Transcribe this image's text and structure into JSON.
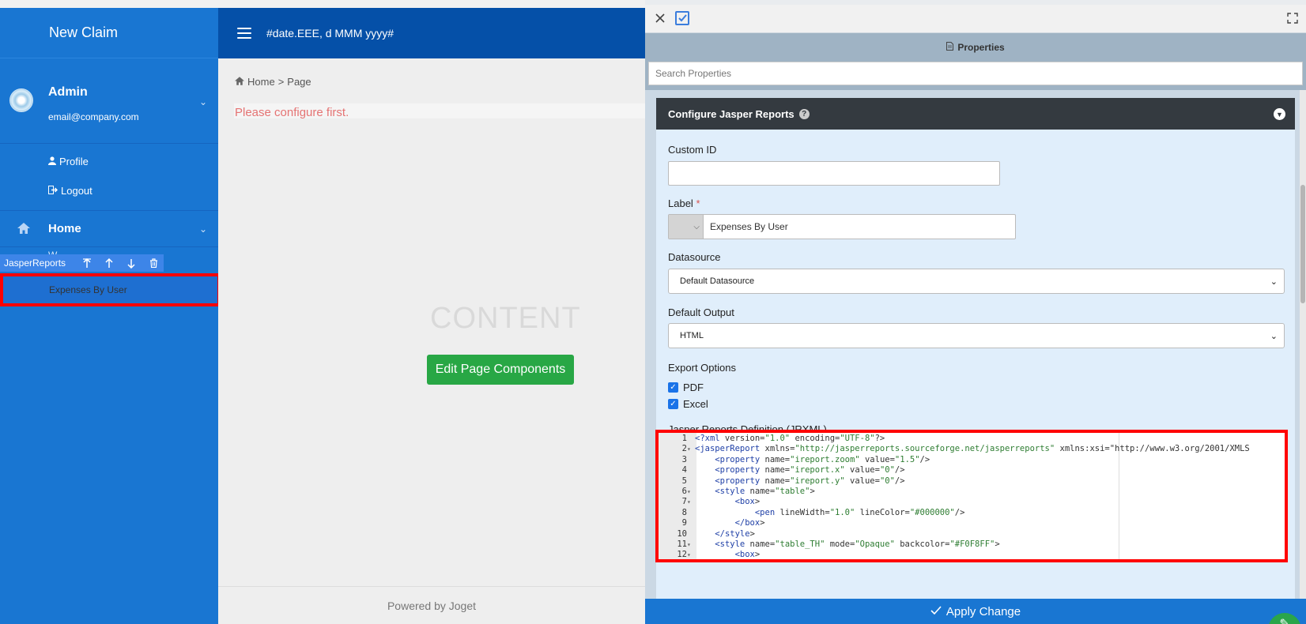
{
  "app": {
    "brand": "New Claim",
    "topbar_date": "#date.EEE, d MMM yyyy#"
  },
  "user": {
    "name": "Admin",
    "email": "email@company.com",
    "menu": [
      {
        "label": "Profile",
        "icon": "user-icon"
      },
      {
        "label": "Logout",
        "icon": "logout-icon"
      }
    ]
  },
  "nav": {
    "home_label": "Home",
    "hidden_item_peek": "W...",
    "builder_toolbar": {
      "label": "JasperReports",
      "actions": [
        "move-up-left-icon",
        "move-up-icon",
        "move-down-icon",
        "delete-icon"
      ]
    },
    "selected_item": "Expenses By User"
  },
  "main": {
    "breadcrumb": {
      "home": "Home",
      "sep": ">",
      "current": "Page"
    },
    "alert": "Please configure first.",
    "content_placeholder": "CONTENT",
    "edit_button": "Edit Page Components",
    "footer": "Powered by Joget"
  },
  "panel": {
    "title": "Properties",
    "search_placeholder": "Search Properties",
    "section_title": "Configure Jasper Reports",
    "fields": {
      "custom_id_label": "Custom ID",
      "custom_id_value": "",
      "label_label": "Label",
      "label_required": "*",
      "label_value": "Expenses By User",
      "datasource_label": "Datasource",
      "datasource_value": "Default Datasource",
      "default_output_label": "Default Output",
      "default_output_value": "HTML",
      "export_options_label": "Export Options",
      "export_options": [
        {
          "label": "PDF",
          "checked": true
        },
        {
          "label": "Excel",
          "checked": true
        }
      ],
      "jrxml_label": "Jasper Reports Definition (JRXML)"
    },
    "code_lines": [
      {
        "n": "1",
        "fold": "",
        "indent": 0,
        "text": "<?xml version=\"1.0\" encoding=\"UTF-8\"?>"
      },
      {
        "n": "2",
        "fold": "▾",
        "indent": 0,
        "text": "<jasperReport xmlns=\"http://jasperreports.sourceforge.net/jasperreports\" xmlns:xsi=\"http://www.w3.org/2001/XMLS"
      },
      {
        "n": "3",
        "fold": "",
        "indent": 1,
        "text": "<property name=\"ireport.zoom\" value=\"1.5\"/>"
      },
      {
        "n": "4",
        "fold": "",
        "indent": 1,
        "text": "<property name=\"ireport.x\" value=\"0\"/>"
      },
      {
        "n": "5",
        "fold": "",
        "indent": 1,
        "text": "<property name=\"ireport.y\" value=\"0\"/>"
      },
      {
        "n": "6",
        "fold": "▾",
        "indent": 1,
        "text": "<style name=\"table\">"
      },
      {
        "n": "7",
        "fold": "▾",
        "indent": 2,
        "text": "<box>"
      },
      {
        "n": "8",
        "fold": "",
        "indent": 3,
        "text": "<pen lineWidth=\"1.0\" lineColor=\"#000000\"/>"
      },
      {
        "n": "9",
        "fold": "",
        "indent": 2,
        "text": "</box>"
      },
      {
        "n": "10",
        "fold": "",
        "indent": 1,
        "text": "</style>"
      },
      {
        "n": "11",
        "fold": "▾",
        "indent": 1,
        "text": "<style name=\"table_TH\" mode=\"Opaque\" backcolor=\"#F0F8FF\">"
      },
      {
        "n": "12",
        "fold": "▾",
        "indent": 2,
        "text": "<box>"
      }
    ],
    "apply_button": "Apply Change"
  },
  "colors": {
    "sidebar": "#1976d2",
    "topbar": "#0550a8",
    "highlight": "#ff0000",
    "edit_button": "#28a745",
    "section_header": "#343a40"
  }
}
